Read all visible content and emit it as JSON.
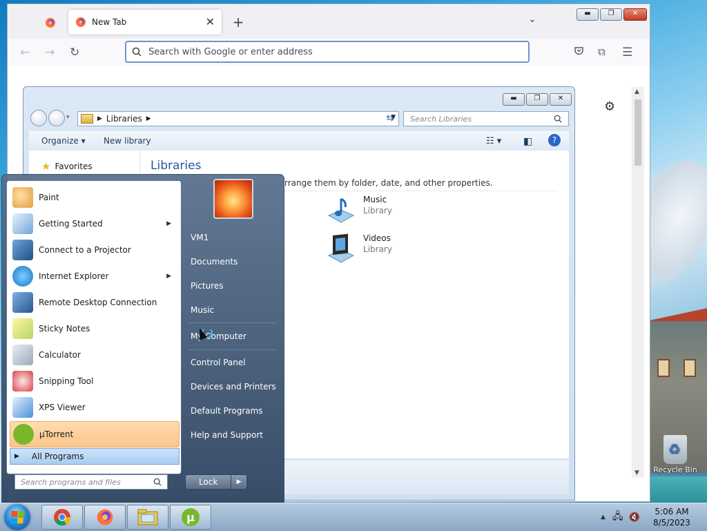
{
  "browser": {
    "tab_title": "New Tab",
    "address_placeholder": "Search with Google or enter address"
  },
  "libraries_window": {
    "breadcrumb": "Libraries",
    "search_placeholder": "Search Libraries",
    "toolbar": {
      "organize": "Organize",
      "new_library": "New library"
    },
    "nav": {
      "favorites": "Favorites"
    },
    "title": "Libraries",
    "description": "rrange them by folder, date, and other properties.",
    "items": [
      {
        "name": "Music",
        "type": "Library"
      },
      {
        "name": "Videos",
        "type": "Library"
      }
    ]
  },
  "start_menu": {
    "programs": [
      {
        "label": "Paint",
        "icon": "paint-icon"
      },
      {
        "label": "Getting Started",
        "icon": "getting-started-icon",
        "submenu": true
      },
      {
        "label": "Connect to a Projector",
        "icon": "projector-icon"
      },
      {
        "label": "Internet Explorer",
        "icon": "internet-explorer-icon",
        "submenu": true
      },
      {
        "label": "Remote Desktop Connection",
        "icon": "remote-desktop-icon"
      },
      {
        "label": "Sticky Notes",
        "icon": "sticky-notes-icon"
      },
      {
        "label": "Calculator",
        "icon": "calculator-icon"
      },
      {
        "label": "Snipping Tool",
        "icon": "snipping-tool-icon"
      },
      {
        "label": "XPS Viewer",
        "icon": "xps-viewer-icon"
      },
      {
        "label": "µTorrent",
        "icon": "utorrent-icon",
        "highlighted": true
      }
    ],
    "all_programs": "All Programs",
    "search_placeholder": "Search programs and files",
    "places": [
      "VM1",
      "Documents",
      "Pictures",
      "Music",
      "My Computer",
      "Control Panel",
      "Devices and Printers",
      "Default Programs",
      "Help and Support"
    ],
    "lock": "Lock"
  },
  "desktop": {
    "recycle_bin": "Recycle Bin"
  },
  "taskbar": {
    "pinned": [
      "chrome-icon",
      "firefox-icon",
      "explorer-icon",
      "utorrent-icon"
    ],
    "time": "5:06 AM",
    "date": "8/5/2023"
  }
}
